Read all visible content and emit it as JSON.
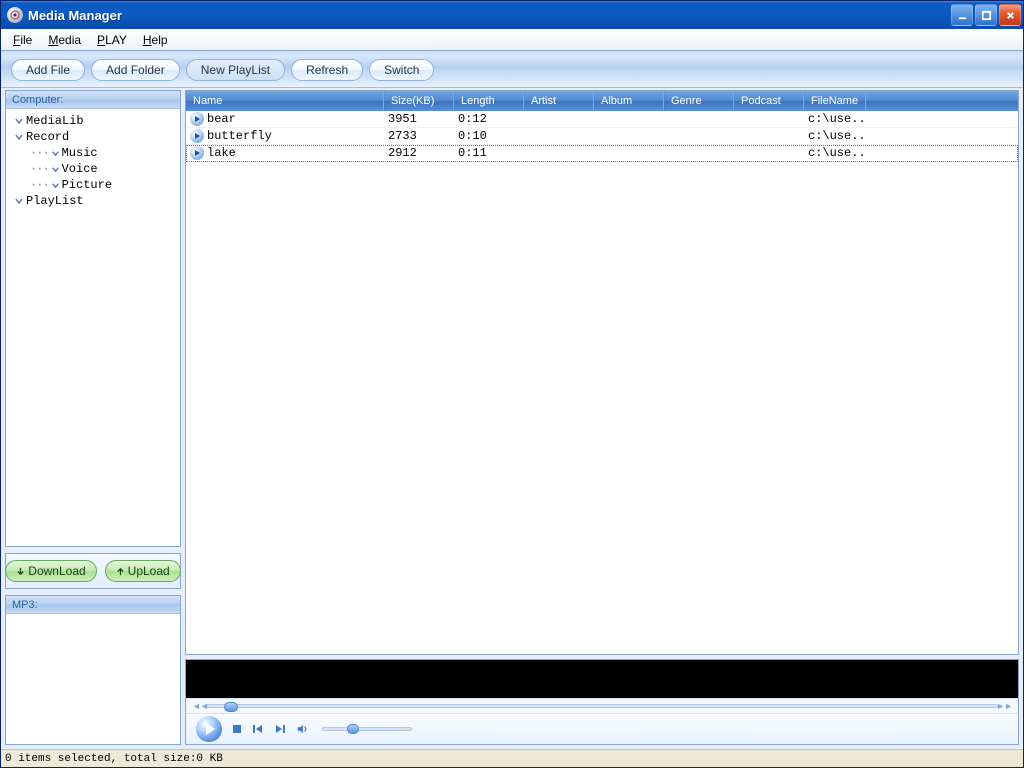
{
  "title": "Media Manager",
  "menu": {
    "file": "File",
    "media": "Media",
    "play": "PLAY",
    "help": "Help"
  },
  "toolbar": {
    "add_file": "Add File",
    "add_folder": "Add Folder",
    "new_playlist": "New PlayList",
    "refresh": "Refresh",
    "switch": "Switch"
  },
  "sidebar": {
    "computer_label": "Computer:",
    "tree": {
      "medialib": "MediaLib",
      "record": "Record",
      "music": "Music",
      "voice": "Voice",
      "picture": "Picture",
      "playlist": "PlayList"
    },
    "download": "DownLoad",
    "upload": "UpLoad",
    "mp3_label": "MP3:"
  },
  "columns": {
    "name": "Name",
    "size": "Size(KB)",
    "length": "Length",
    "artist": "Artist",
    "album": "Album",
    "genre": "Genre",
    "podcast": "Podcast",
    "filename": "FileName"
  },
  "rows": [
    {
      "name": "bear",
      "size": "3951",
      "length": "0:12",
      "filename": "c:\\use..."
    },
    {
      "name": "butterfly",
      "size": "2733",
      "length": "0:10",
      "filename": "c:\\use..."
    },
    {
      "name": "lake",
      "size": "2912",
      "length": "0:11",
      "filename": "c:\\use..."
    }
  ],
  "status": "0 items selected, total size:0 KB"
}
